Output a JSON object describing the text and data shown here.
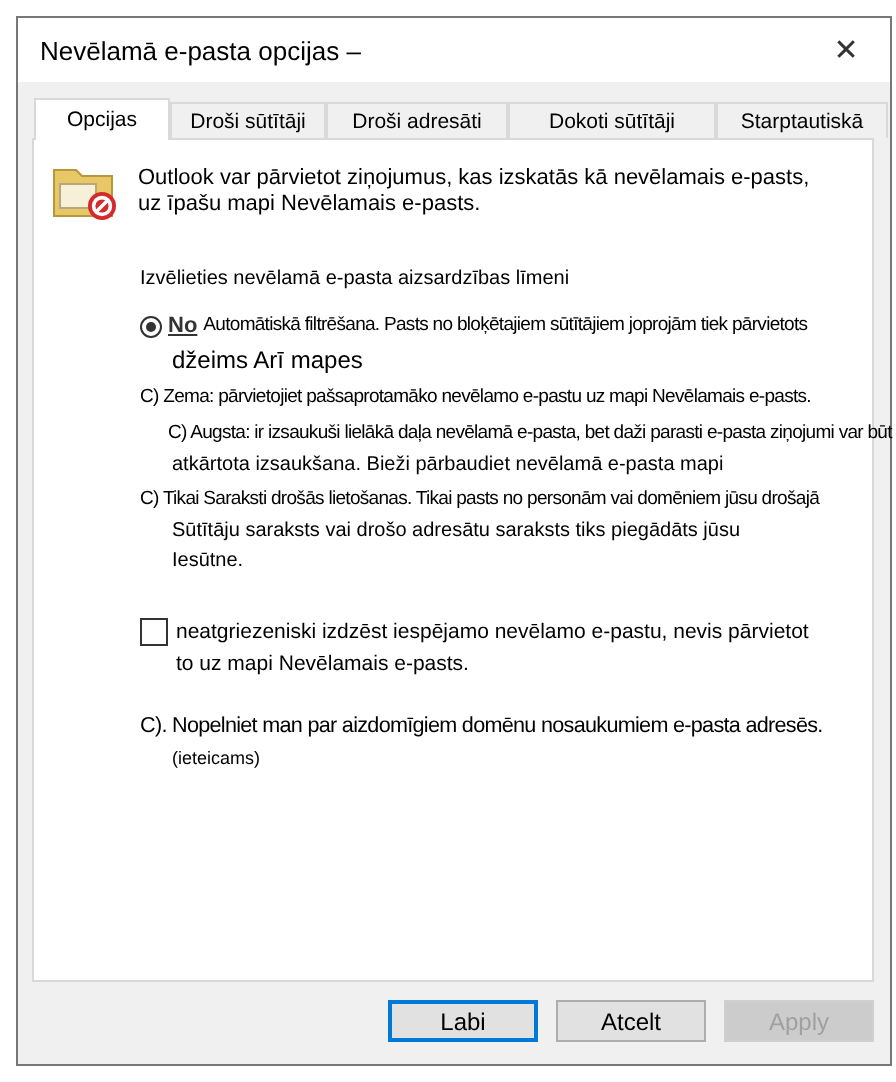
{
  "window": {
    "title": "Nevēlamā e-pasta opcijas –",
    "close": "✕"
  },
  "tabs": [
    {
      "label": "Opcijas",
      "selected": true
    },
    {
      "label": "Droši sūtītāji",
      "selected": false
    },
    {
      "label": "Droši adresāti",
      "selected": false
    },
    {
      "label": "Dokoti sūtītāji",
      "selected": false
    },
    {
      "label": "Starptautiskā",
      "selected": false
    }
  ],
  "intro": "Outlook var pārvietot ziņojumus, kas izskatās kā nevēlamais e-pasts, uz īpašu mapi Nevēlamais e-pasts.",
  "level_heading": "Izvēlieties nevēlamā e-pasta aizsardzības līmeni",
  "levels": [
    {
      "kind": "radio",
      "selected": true,
      "label": "No",
      "text": "Automātiskā filtrēšana. Pasts no bloķētajiem sūtītājiem joprojām tiek pārvietots",
      "continuation": "džeims Arī mapes"
    },
    {
      "kind": "text",
      "text": "C) Zema: pārvietojiet pašsaprotamāko nevēlamo e-pastu uz mapi Nevēlamais e-pasts."
    },
    {
      "kind": "indented",
      "text": "C) Augsta: ir izsaukuši lielākā daļa nevēlamā e-pasta, bet daži parasti e-pasta ziņojumi var būt",
      "continuation": "atkārtota izsaukšana. Bieži pārbaudiet nevēlamā e-pasta mapi"
    },
    {
      "kind": "text",
      "text": "C) Tikai Saraksti drošās lietošanas. Tikai pasts no personām vai domēniem jūsu drošajā",
      "continuation": "Sūtītāju saraksts vai drošo adresātu saraksts tiks piegādāts jūsu",
      "continuation_2": "Iesūtne."
    }
  ],
  "delete_option": {
    "checked": false,
    "label": "neatgriezeniski izdzēst iespējamo nevēlamo e-pastu, nevis pārvietot to uz mapi Nevēlamais e-pasts."
  },
  "warn_option": {
    "text": "C). Nopelniet man par aizdomīgiem domēnu nosaukumiem e-pasta adresēs.",
    "note": "(ieteicams)"
  },
  "buttons": [
    {
      "label": "Labi",
      "default": true,
      "disabled": false
    },
    {
      "label": "Atcelt",
      "default": false,
      "disabled": false
    },
    {
      "label": "Apply",
      "default": false,
      "disabled": true
    }
  ]
}
